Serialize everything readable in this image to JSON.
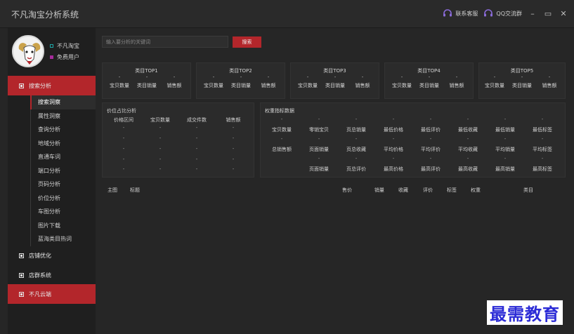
{
  "app": {
    "title": "不凡淘宝分析系统",
    "contact_service": "联系客服",
    "qq_group": "QQ交流群"
  },
  "user": {
    "name": "不凡淘宝",
    "role": "免费用户"
  },
  "sidebar": {
    "sections": [
      {
        "label": "搜索分析",
        "active": true
      },
      {
        "label": "店铺优化",
        "active": false
      },
      {
        "label": "店群系统",
        "active": false
      },
      {
        "label": "不凡云端",
        "active": true
      }
    ],
    "subitems": [
      "搜索洞察",
      "属性洞察",
      "查询分析",
      "地域分析",
      "直通车词",
      "端口分析",
      "页码分析",
      "价位分析",
      "车图分析",
      "图片下载",
      "蓝海类目热词"
    ]
  },
  "search": {
    "placeholder": "输入要分析的关键词",
    "button": "搜索"
  },
  "category_top": [
    {
      "title": "类目TOP1",
      "cols": [
        "宝贝数量",
        "类目销量",
        "销售额"
      ],
      "vals": [
        "-",
        "-",
        "-"
      ]
    },
    {
      "title": "类目TOP2",
      "cols": [
        "宝贝数量",
        "类目销量",
        "销售额"
      ],
      "vals": [
        "-",
        "-",
        "-"
      ]
    },
    {
      "title": "类目TOP3",
      "cols": [
        "宝贝数量",
        "类目销量",
        "销售额"
      ],
      "vals": [
        "-",
        "-",
        "-"
      ]
    },
    {
      "title": "类目TOP4",
      "cols": [
        "宝贝数量",
        "类目销量",
        "销售额"
      ],
      "vals": [
        "-",
        "-",
        "-"
      ]
    },
    {
      "title": "类目TOP5",
      "cols": [
        "宝贝数量",
        "类目销量",
        "销售额"
      ],
      "vals": [
        "-",
        "-",
        "-"
      ]
    }
  ],
  "price_ratio": {
    "title": "价位占比分析",
    "headers": [
      "价格区间",
      "宝贝数量",
      "成交件数",
      "销售额"
    ],
    "rows": [
      [
        "-",
        "-",
        "-",
        "-"
      ],
      [
        "-",
        "-",
        "-",
        "-"
      ],
      [
        "-",
        "-",
        "-",
        "-"
      ],
      [
        "-",
        "-",
        "-",
        "-"
      ],
      [
        "-",
        "-",
        "-",
        "-"
      ]
    ]
  },
  "weight": {
    "title": "权重指标数据",
    "rows": [
      {
        "vals": [
          "-",
          "-",
          "-",
          "-",
          "-",
          "-",
          "-",
          "-"
        ],
        "labels": [
          "宝贝数量",
          "零销宝贝",
          "页总销量",
          "最低价格",
          "最低评价",
          "最低收藏",
          "最低销量",
          "最低标签"
        ]
      },
      {
        "vals": [
          "-",
          "-",
          "-",
          "-",
          "-",
          "-",
          "-",
          "-"
        ],
        "labels": [
          "总销售额",
          "页面销量",
          "页总收藏",
          "平均价格",
          "平均评价",
          "平均收藏",
          "平均销量",
          "平均标签"
        ]
      },
      {
        "vals": [
          "",
          "-",
          "-",
          "-",
          "-",
          "-",
          "-",
          "-"
        ],
        "labels": [
          "",
          "页面销量",
          "页总评价",
          "最高价格",
          "最高评价",
          "最高收藏",
          "最高销量",
          "最高标签"
        ]
      }
    ]
  },
  "results": {
    "columns": [
      "主图",
      "标题",
      "售价",
      "销量",
      "收藏",
      "评价",
      "标签",
      "权重",
      "类目"
    ]
  },
  "watermark": "最需教育"
}
